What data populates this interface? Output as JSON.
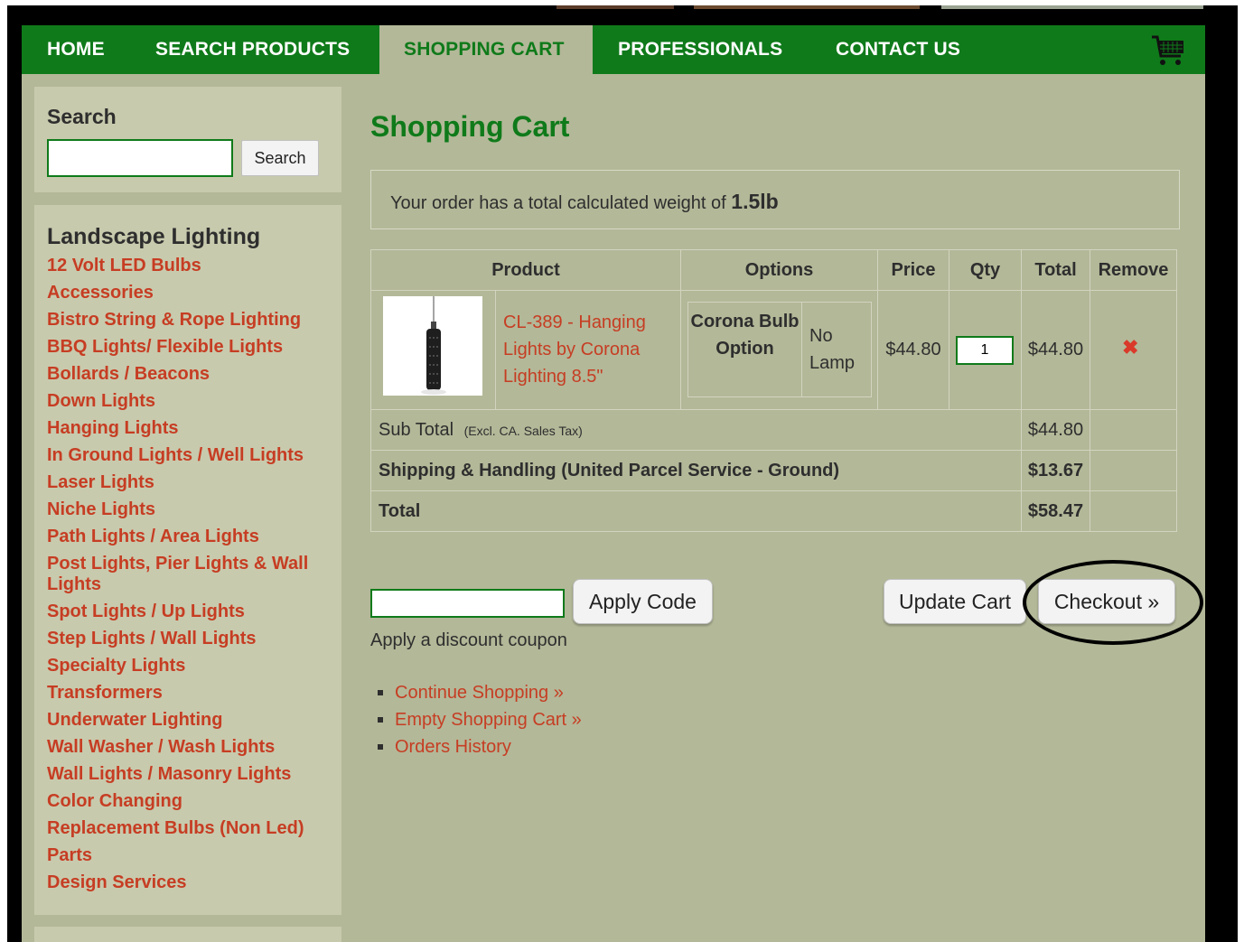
{
  "nav": {
    "items": [
      {
        "label": "HOME"
      },
      {
        "label": "SEARCH PRODUCTS"
      },
      {
        "label": "SHOPPING CART"
      },
      {
        "label": "PROFESSIONALS"
      },
      {
        "label": "CONTACT US"
      }
    ],
    "active_index": 2,
    "cart_icon": "shopping-cart-icon"
  },
  "sidebar": {
    "search_title": "Search",
    "search_value": "",
    "search_button": "Search",
    "categories_title": "Landscape Lighting",
    "categories": [
      "12 Volt LED Bulbs",
      "Accessories",
      "Bistro String & Rope Lighting",
      "BBQ Lights/ Flexible Lights",
      "Bollards / Beacons",
      "Down Lights",
      "Hanging Lights",
      "In Ground Lights / Well Lights",
      "Laser Lights",
      "Niche Lights",
      "Path Lights / Area Lights",
      "Post Lights, Pier Lights & Wall Lights",
      "Spot Lights / Up Lights",
      "Step Lights / Wall Lights",
      "Specialty Lights",
      "Transformers",
      "Underwater Lighting",
      "Wall Washer / Wash Lights",
      "Wall Lights / Masonry Lights",
      "Color Changing",
      "Replacement Bulbs (Non Led)",
      "Parts",
      "Design Services"
    ]
  },
  "cart": {
    "title": "Shopping Cart",
    "weight_prefix": "Your order has a total calculated weight of ",
    "weight_value": "1.5lb",
    "headers": {
      "product": "Product",
      "options": "Options",
      "price": "Price",
      "qty": "Qty",
      "total": "Total",
      "remove": "Remove"
    },
    "items": [
      {
        "name": "CL-389 - Hanging Lights by Corona Lighting 8.5\"",
        "option_name": "Corona Bulb Option",
        "option_value": "No Lamp",
        "price": "$44.80",
        "qty": "1",
        "total": "$44.80",
        "remove_icon": "remove-x-icon"
      }
    ],
    "subtotal_label": "Sub Total",
    "subtotal_note": "(Excl. CA. Sales Tax)",
    "subtotal_value": "$44.80",
    "shipping_label": "Shipping & Handling (United Parcel Service - Ground)",
    "shipping_value": "$13.67",
    "total_label": "Total",
    "total_value": "$58.47",
    "coupon_value": "",
    "apply_code_label": "Apply Code",
    "coupon_note": "Apply a discount coupon",
    "update_cart_label": "Update Cart",
    "checkout_label": "Checkout »",
    "links": [
      "Continue Shopping »",
      "Empty Shopping Cart »",
      "Orders History"
    ]
  },
  "colors": {
    "nav_green": "#0f7a1a",
    "page_bg": "#b3b898",
    "panel_bg": "#c8caad",
    "link_red": "#c63d23",
    "remove_red": "#d93a2a"
  }
}
